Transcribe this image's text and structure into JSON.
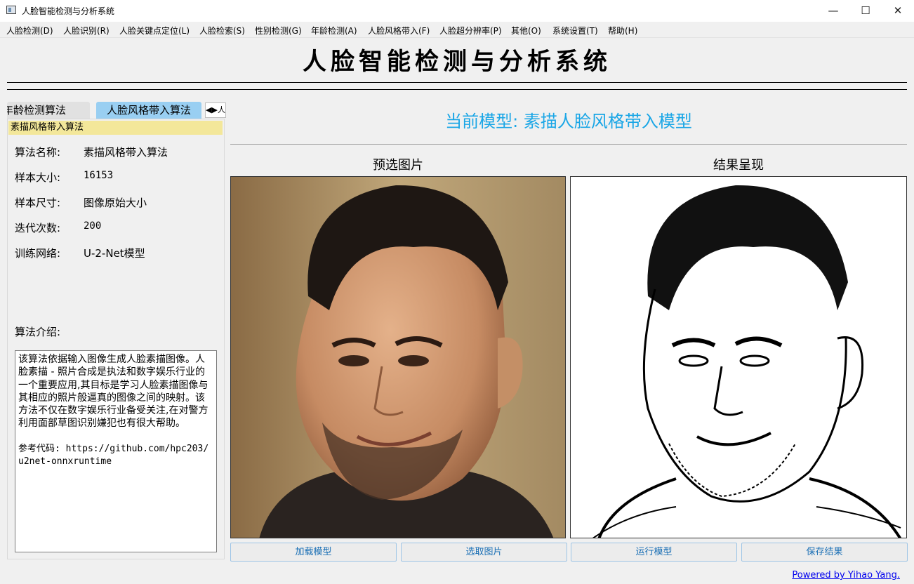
{
  "window": {
    "title": "人脸智能检测与分析系统",
    "minimize_glyph": "—",
    "maximize_glyph": "☐",
    "close_glyph": "✕"
  },
  "menu": [
    "人脸检测(D)",
    "人脸识别(R)",
    "人脸关键点定位(L)",
    "人脸检索(S)",
    "性别检测(G)",
    "年龄检测(A)",
    "人脸风格带入(F)",
    "人脸超分辨率(P)",
    "其他(O)",
    "系统设置(T)",
    "帮助(H)"
  ],
  "heading": "人脸智能检测与分析系统",
  "tabs": {
    "age": "年龄检测算法",
    "style": "人脸风格带入算法",
    "scroll": "◀▶人"
  },
  "panel": {
    "group_title": "素描风格带入算法",
    "props": [
      {
        "label": "算法名称:",
        "value": "素描风格带入算法"
      },
      {
        "label": "样本大小:",
        "value": "16153"
      },
      {
        "label": "样本尺寸:",
        "value": "图像原始大小"
      },
      {
        "label": "迭代次数:",
        "value": "200"
      },
      {
        "label": "训练网络:",
        "value": "U-2-Net模型"
      }
    ],
    "intro_label": "算法介绍:",
    "intro_text": "该算法依据输入图像生成人脸素描图像。人脸素描 - 照片合成是执法和数字娱乐行业的一个重要应用,其目标是学习人脸素描图像与其相应的照片般逼真的图像之间的映射。该方法不仅在数字娱乐行业备受关注,在对警方利用面部草图识别嫌犯也有很大帮助。",
    "intro_ref": "参考代码: https://github.com/hpc203/u2net-onnxruntime"
  },
  "main": {
    "model_title": "当前模型: 素描人脸风格带入模型",
    "preview_caption": "预选图片",
    "result_caption": "结果呈现"
  },
  "buttons": {
    "load": "加载模型",
    "select": "选取图片",
    "run": "运行模型",
    "save": "保存结果"
  },
  "footer": "Powered by Yihao Yang.",
  "colors": {
    "accent": "#1aa6e6",
    "active_tab": "#99cff2",
    "group_title_bg": "#f3e79a"
  }
}
